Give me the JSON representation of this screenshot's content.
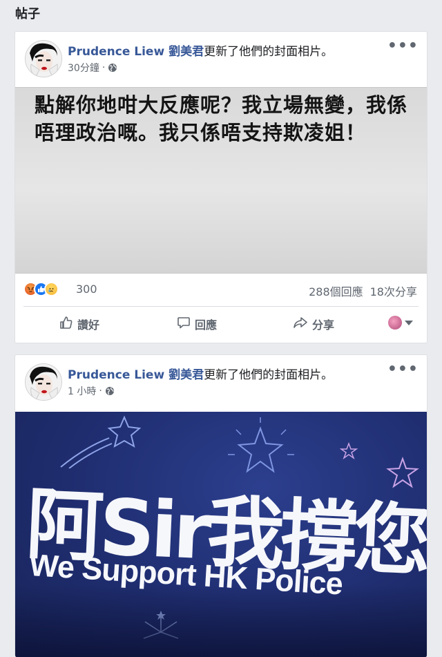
{
  "section_title": "帖子",
  "posts": [
    {
      "author": "Prudence Liew 劉美君",
      "action": "更新了他們的封面相片。",
      "time": "30分鐘",
      "meta_sep": "·",
      "cover_text": "點解你地咁大反應呢？我立場無變，我係唔理政治嘅。我只係唔支持欺凌姐！",
      "reaction_count": "300",
      "comments": "288個回應",
      "shares": "18次分享",
      "actions": {
        "like": "讚好",
        "comment": "回應",
        "share": "分享"
      }
    },
    {
      "author": "Prudence Liew 劉美君",
      "action": "更新了他們的封面相片。",
      "time": "1 小時",
      "meta_sep": "·",
      "sign_chinese": "阿Sir我撐您",
      "sign_english": "We Support HK Police"
    }
  ],
  "icons": [
    "avatar",
    "globe-icon",
    "more-icon",
    "angry-reaction-icon",
    "like-reaction-icon",
    "sad-reaction-icon",
    "thumbs-up-icon",
    "comment-icon",
    "share-icon",
    "caret-down-icon"
  ],
  "colors": {
    "author_link": "#385898",
    "like_blue": "#1877f2",
    "background": "#e9ebee",
    "sign_background": "#1f2d6f"
  }
}
